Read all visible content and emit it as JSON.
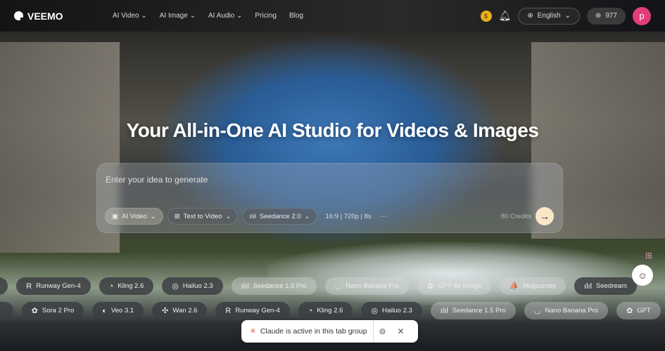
{
  "nav": {
    "brand": "VEEMO",
    "menu": [
      "AI Video ⌄",
      "AI Image ⌄",
      "AI Audio ⌄",
      "Pricing",
      "Blog"
    ],
    "coin": "$",
    "language": "English",
    "credits": "977",
    "avatar": "p"
  },
  "hero": {
    "title": "Your All-in-One AI Studio for Videos & Images"
  },
  "prompt": {
    "placeholder": "Enter your idea to generate",
    "mode": "AI Video",
    "type": "Text to Video",
    "model": "Seedance 2.0",
    "settings": "16:9 | 720p | 8s",
    "more": "···",
    "cost": "80 Credits"
  },
  "models_row1": [
    {
      "label": "Runway Gen-4",
      "icon": "R"
    },
    {
      "label": "Kling 2.6",
      "icon": "◔"
    },
    {
      "label": "Hailuo 2.3",
      "icon": "◎"
    },
    {
      "label": "Seedance 1.5 Pro",
      "icon": "ılıl"
    },
    {
      "label": "Nano Banana Pro",
      "icon": "◡"
    },
    {
      "label": "GPT-4o Image",
      "icon": "✿"
    },
    {
      "label": "Midjourney",
      "icon": "⛵"
    },
    {
      "label": "Seedream",
      "icon": "ılıl"
    }
  ],
  "models_row2": [
    {
      "label": "Sora 2 Pro",
      "icon": "✿"
    },
    {
      "label": "Veo 3.1",
      "icon": "◐"
    },
    {
      "label": "Wan 2.6",
      "icon": "✣"
    },
    {
      "label": "Runway Gen-4",
      "icon": "R"
    },
    {
      "label": "Kling 2.6",
      "icon": "◔"
    },
    {
      "label": "Hailuo 2.3",
      "icon": "◎"
    },
    {
      "label": "Seedance 1.5 Pro",
      "icon": "ılıl"
    },
    {
      "label": "Nano Banana Pro",
      "icon": "◡"
    },
    {
      "label": "GPT",
      "icon": "✿"
    }
  ],
  "claude_bar": {
    "text": "Claude is active in this tab group"
  }
}
